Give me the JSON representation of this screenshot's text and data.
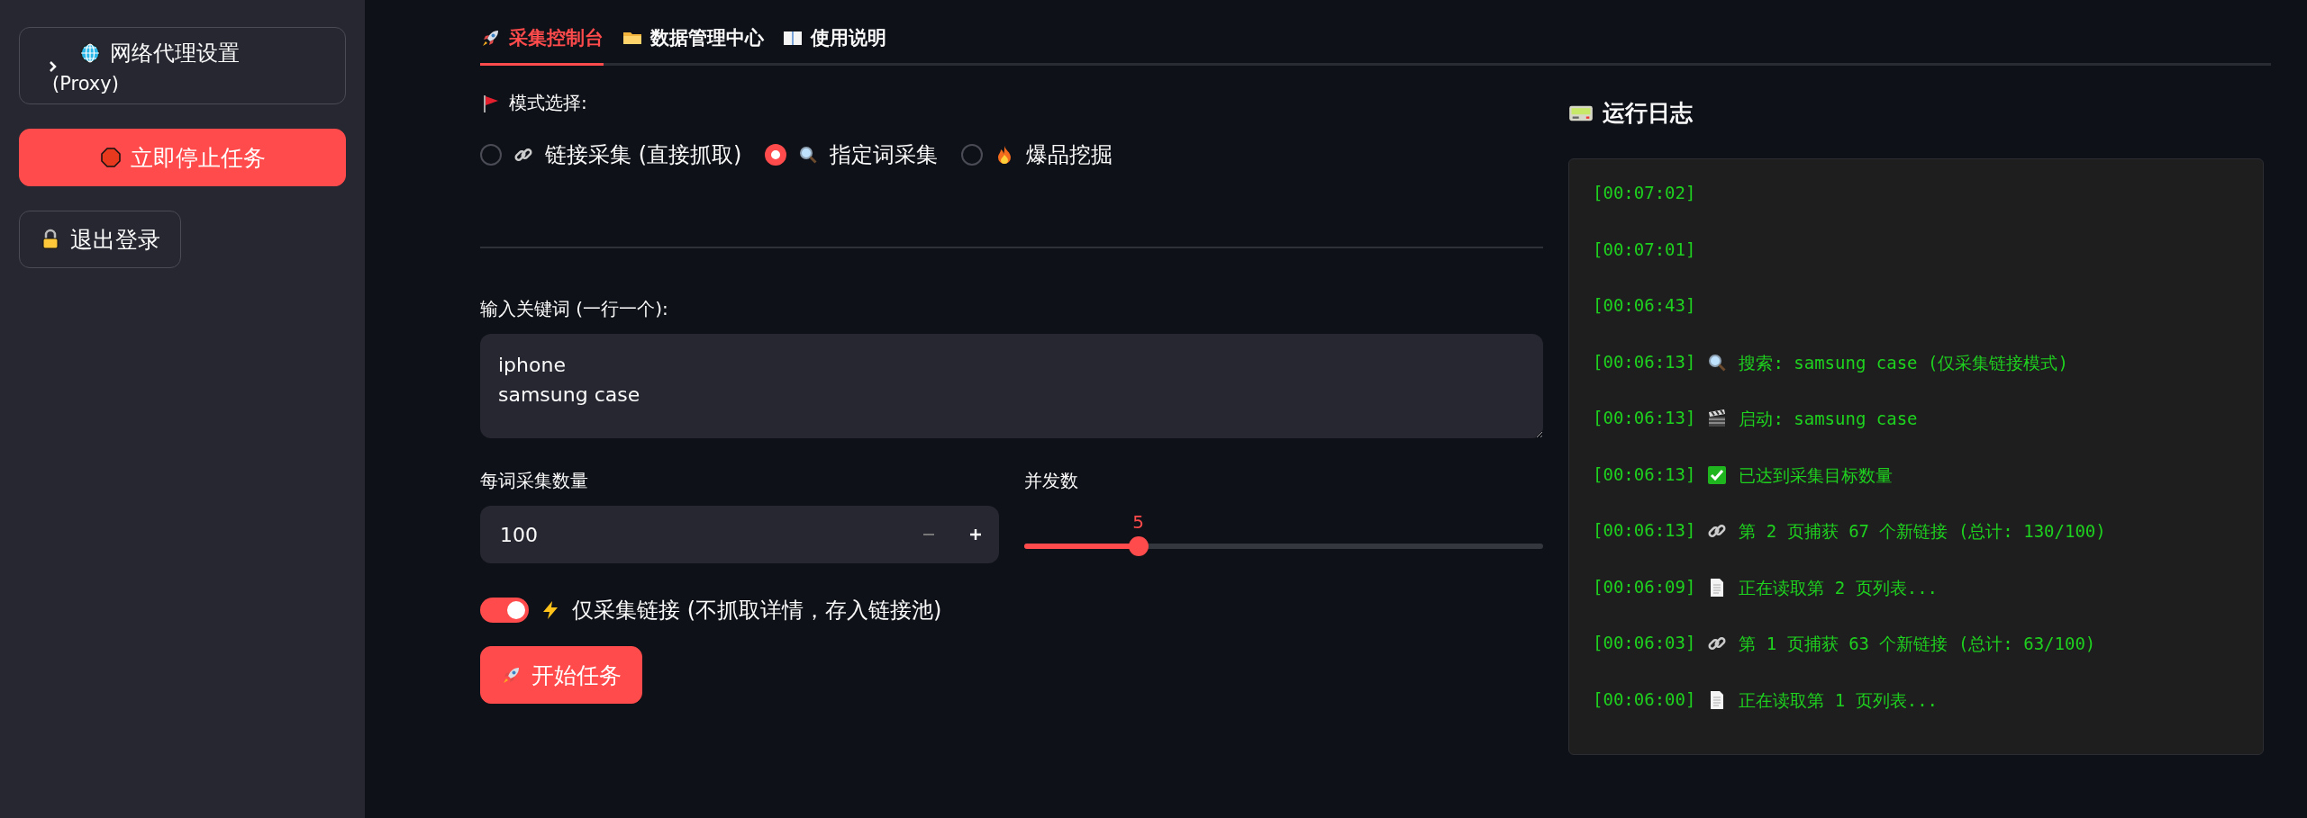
{
  "sidebar": {
    "expander": {
      "title": "网络代理设置",
      "subtitle": "(Proxy)",
      "expanded": false
    },
    "stop_button": "立即停止任务",
    "logout_button": "退出登录"
  },
  "tabs": [
    {
      "label": "采集控制台",
      "kind": "rocket",
      "selected": true
    },
    {
      "label": "数据管理中心",
      "kind": "folder",
      "selected": false
    },
    {
      "label": "使用说明",
      "kind": "book",
      "selected": false
    }
  ],
  "mode": {
    "label": "模式选择:",
    "options": [
      {
        "label": "链接采集 (直接抓取)",
        "kind": "link",
        "selected": false
      },
      {
        "label": "指定词采集",
        "kind": "search",
        "selected": true
      },
      {
        "label": "爆品挖掘",
        "kind": "fire",
        "selected": false
      }
    ]
  },
  "keywords": {
    "label": "输入关键词 (一行一个):",
    "value": "iphone\nsamsung case"
  },
  "count": {
    "label": "每词采集数量",
    "value": "100"
  },
  "concurrency": {
    "label": "并发数",
    "reading": "5",
    "level": 0.22
  },
  "links_only": {
    "label": "仅采集链接 (不抓取详情，存入链接池)",
    "on": true
  },
  "start_button": "开始任务",
  "log": {
    "title": "运行日志",
    "entries": [
      {
        "time": "[00:07:02]",
        "kind": "none"
      },
      {
        "time": "[00:07:01]",
        "kind": "none"
      },
      {
        "time": "[00:06:43]",
        "kind": "none"
      },
      {
        "time": "[00:06:13]",
        "kind": "search",
        "text": "搜索: samsung case (仅采集链接模式)"
      },
      {
        "time": "[00:06:13]",
        "kind": "clapper",
        "text": "启动: samsung case"
      },
      {
        "time": "[00:06:13]",
        "kind": "check",
        "text": "已达到采集目标数量"
      },
      {
        "time": "[00:06:13]",
        "kind": "link",
        "text": "第 2 页捕获 67 个新链接 (总计: 130/100)"
      },
      {
        "time": "[00:06:09]",
        "kind": "page",
        "text": "正在读取第 2 页列表..."
      },
      {
        "time": "[00:06:03]",
        "kind": "link",
        "text": "第 1 页捕获 63 个新链接 (总计: 63/100)"
      },
      {
        "time": "[00:06:00]",
        "kind": "page",
        "text": "正在读取第 1 页列表..."
      }
    ]
  }
}
